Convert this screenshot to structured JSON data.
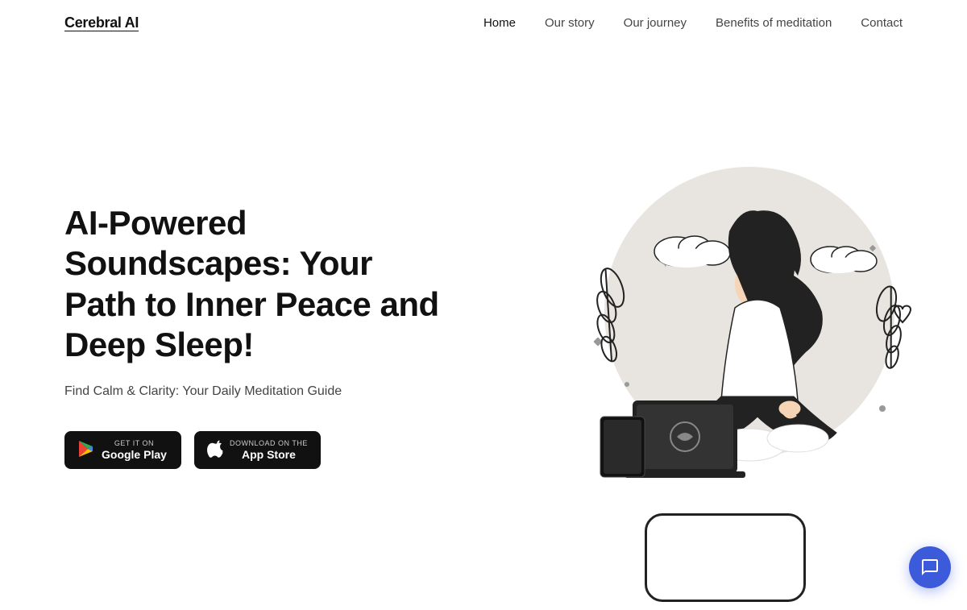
{
  "nav": {
    "logo": "Cerebral AI",
    "links": [
      {
        "id": "home",
        "label": "Home",
        "active": true
      },
      {
        "id": "our-story",
        "label": "Our story",
        "active": false
      },
      {
        "id": "our-journey",
        "label": "Our journey",
        "active": false
      },
      {
        "id": "benefits",
        "label": "Benefits of meditation",
        "active": false
      },
      {
        "id": "contact",
        "label": "Contact",
        "active": false
      }
    ]
  },
  "hero": {
    "title": "AI-Powered Soundscapes: Your Path to Inner Peace and Deep Sleep!",
    "subtitle": "Find Calm & Clarity: Your Daily Meditation Guide",
    "google_play_sub": "GET IT ON",
    "google_play_label": "Google Play",
    "app_store_sub": "Download on the",
    "app_store_label": "App Store"
  },
  "chat": {
    "icon": "💬"
  }
}
